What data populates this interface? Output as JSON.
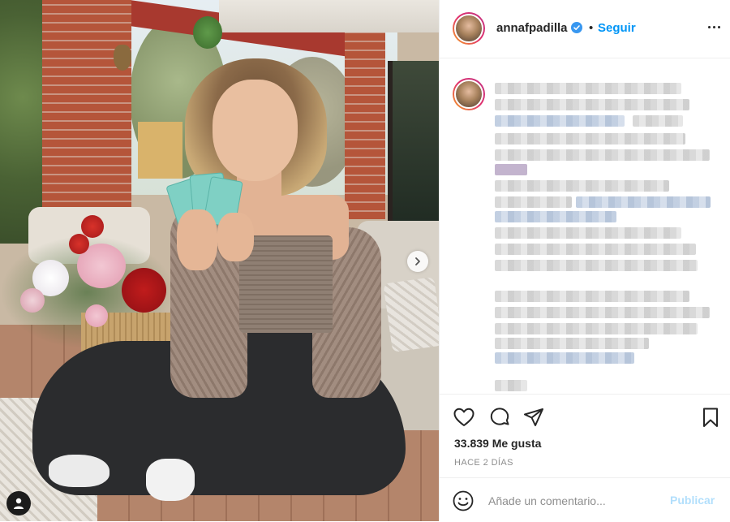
{
  "post": {
    "username": "annafpadilla",
    "verified": true,
    "separator": "•",
    "follow_label": "Seguir",
    "more_icon": "more-horizontal-icon",
    "likes_text": "33.839 Me gusta",
    "time_text": "HACE 2 DÍAS",
    "caption_blurred": true
  },
  "actions": {
    "like_icon": "heart-icon",
    "comment_icon": "comment-icon",
    "share_icon": "paper-plane-icon",
    "save_icon": "bookmark-icon"
  },
  "comment_box": {
    "placeholder": "Añade un comentario...",
    "publish_label": "Publicar",
    "emoji_icon": "smiley-icon"
  },
  "colors": {
    "accent": "#0095f6",
    "publish_disabled": "#b2dffc",
    "text": "#262626",
    "muted": "#8e8e8e",
    "border": "#efefef"
  }
}
